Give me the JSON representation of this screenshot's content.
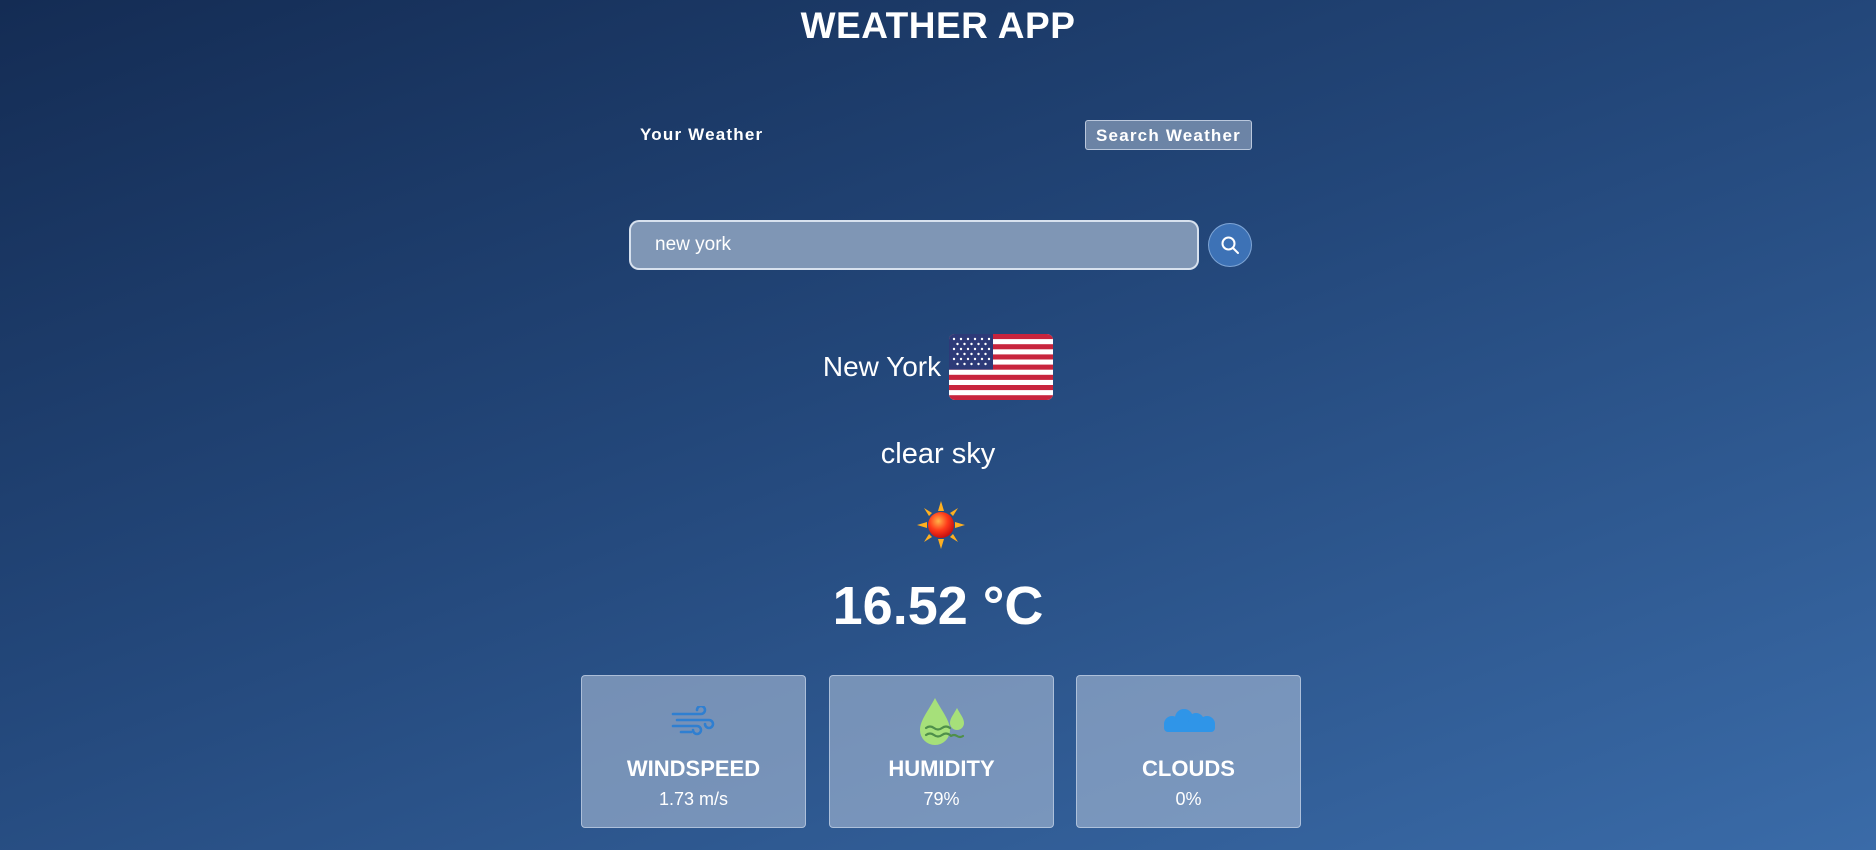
{
  "app": {
    "title": "WEATHER APP"
  },
  "nav": {
    "tabs": [
      {
        "label": "Your Weather",
        "active": false
      },
      {
        "label": "Search Weather",
        "active": true
      }
    ]
  },
  "search": {
    "value": "new york",
    "icon": "search-icon"
  },
  "weather": {
    "city": "New York",
    "flag_icon": "us-flag-icon",
    "description": "clear sky",
    "condition_icon": "sun-icon",
    "temperature": "16.52 °C"
  },
  "stats": [
    {
      "label": "WINDSPEED",
      "value": "1.73 m/s",
      "icon": "wind-icon"
    },
    {
      "label": "HUMIDITY",
      "value": "79%",
      "icon": "humidity-icon"
    },
    {
      "label": "CLOUDS",
      "value": "0%",
      "icon": "clouds-icon"
    }
  ],
  "colors": {
    "search_button": "#3d72b6",
    "wind_icon": "#2f7fd1",
    "humidity_icon": "#a6e07a",
    "clouds_icon": "#2f95e8"
  }
}
